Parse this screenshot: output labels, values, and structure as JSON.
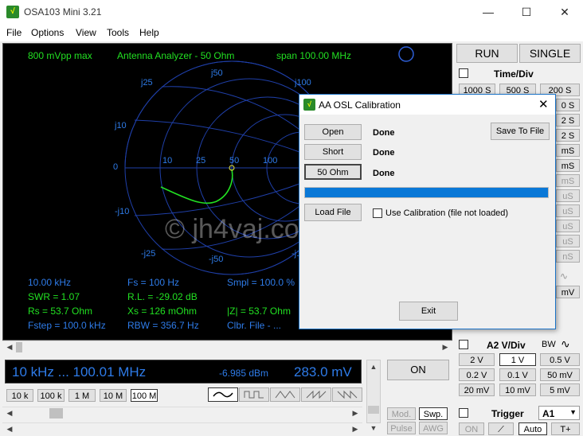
{
  "window": {
    "title": "OSA103 Mini 3.21",
    "min": "—",
    "max": "☐",
    "close": "✕"
  },
  "menu": [
    "File",
    "Options",
    "View",
    "Tools",
    "Help"
  ],
  "scope": {
    "top_left": "800 mVpp max",
    "top_mid": "Antenna Analyzer - 50 Ohm",
    "top_right": "span 100.00 MHz",
    "smith_labels": {
      "j50": "j50",
      "j25": "j25",
      "j100": "j100",
      "j10": "j10",
      "zero": "0",
      "mj10": "-j10",
      "mj25": "-j25",
      "mj50": "-j50",
      "mj100": "-j100",
      "r10": "10",
      "r25": "25",
      "r50": "50",
      "r100": "100"
    },
    "watermark": "© jh4vaj.com",
    "readouts": [
      {
        "c1": "10.00 kHz",
        "c2": "Fs = 100 Hz",
        "c3": "Smpl = 100.0 %"
      },
      {
        "c1": "SWR = 1.07",
        "c2": "R.L. = -29.02 dB",
        "c3": ""
      },
      {
        "c1": "Rs = 53.7 Ohm",
        "c2": "Xs = 126 mOhm",
        "c3": "|Z| = 53.7 Ohm"
      },
      {
        "c1": "Fstep = 100.0 kHz",
        "c2": "RBW = 356.7 Hz",
        "c3": "Clbr. File - ..."
      }
    ]
  },
  "readout_bar": {
    "freq": "10 kHz  ...  100.01 MHz",
    "dbm": "-6.985 dBm",
    "mv": "283.0 mV"
  },
  "on_button": "ON",
  "freq_buttons": [
    "10 k",
    "100 k",
    "1 M",
    "10 M",
    "100 M"
  ],
  "mode_buttons": {
    "mod": "Mod.",
    "swp": "Swp.",
    "pulse": "Pulse",
    "awg": "AWG"
  },
  "right": {
    "run": "RUN",
    "single": "SINGLE",
    "time_div": "Time/Div",
    "time_buttons": [
      [
        "1000 S",
        "500 S",
        "200 S"
      ]
    ],
    "time_partial": [
      "0 S",
      "2 S",
      "2 S",
      "mS",
      "mS",
      "mS",
      "uS",
      "uS",
      "uS",
      "uS",
      "nS",
      "nS",
      "mV"
    ],
    "a2_title": "A2 V/Div",
    "bw": "BW",
    "vdiv": [
      "2 V",
      "1 V",
      "0.5 V",
      "0.2 V",
      "0.1 V",
      "50 mV",
      "20 mV",
      "10 mV",
      "5 mV"
    ],
    "trigger": "Trigger",
    "trig_src": "A1",
    "on": "ON",
    "auto": "Auto",
    "tplus": "T+"
  },
  "dialog": {
    "title": "AA OSL Calibration",
    "open": "Open",
    "short": "Short",
    "load": "50 Ohm",
    "open_status": "Done",
    "short_status": "Done",
    "load_status": "Done",
    "save": "Save To File",
    "load_file": "Load File",
    "use_cal": "Use Calibration (file not loaded)",
    "exit": "Exit",
    "progress": 1.0
  },
  "colors": {
    "trace": "#22e022",
    "grid": "#1f3fa8",
    "text_blue": "#2e7be8",
    "progress": "#0a78d7"
  }
}
